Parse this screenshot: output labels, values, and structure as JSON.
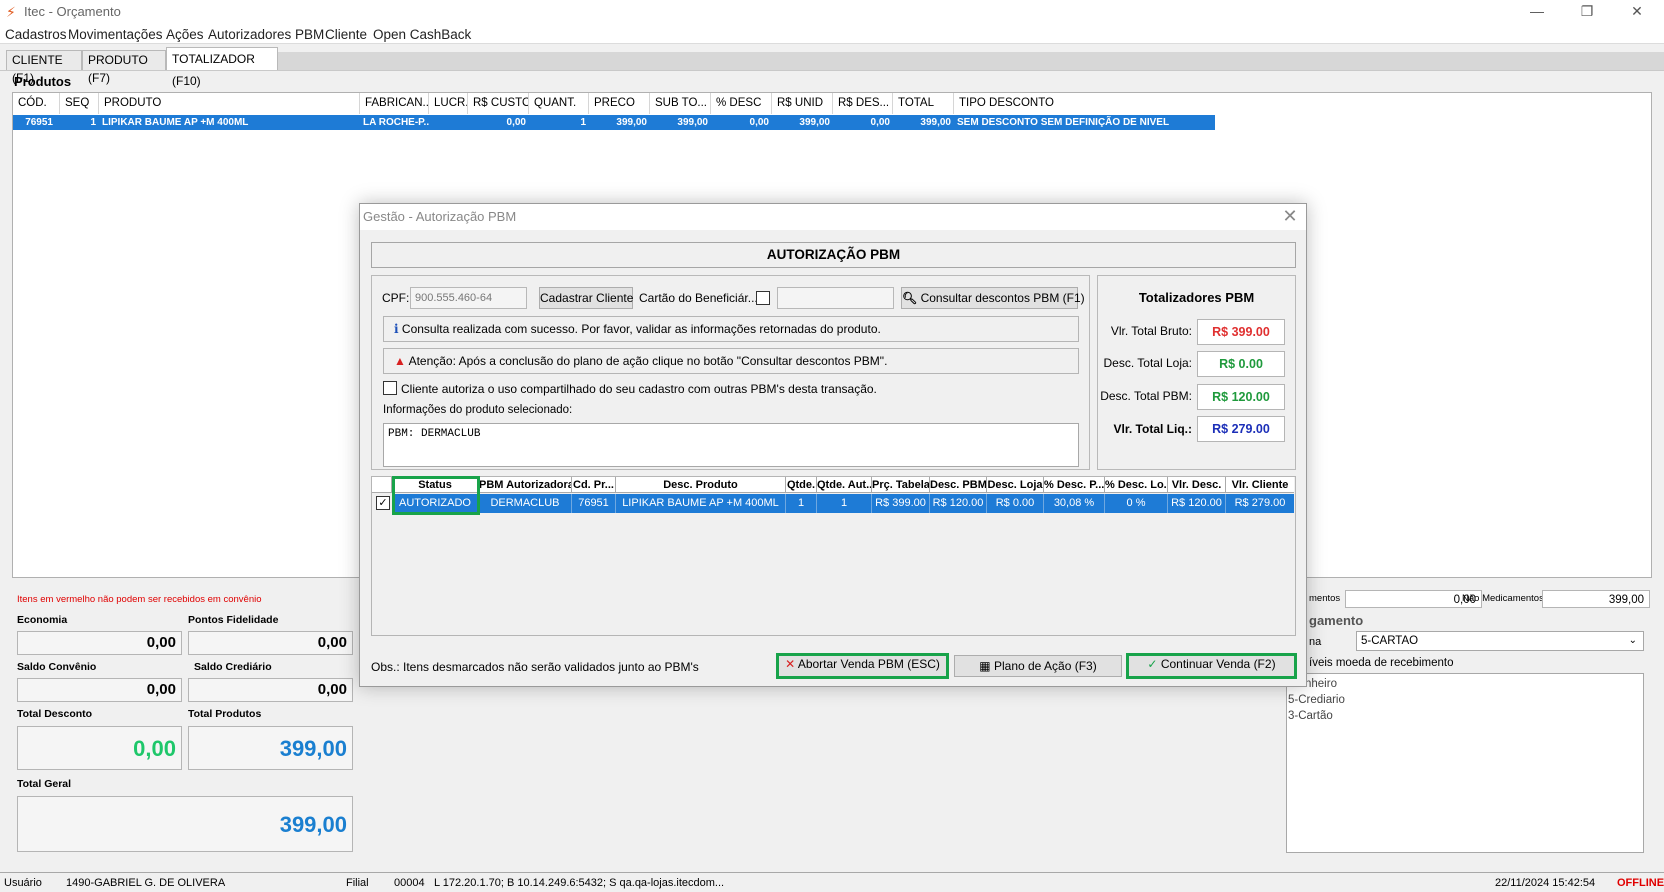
{
  "window": {
    "title": "Itec - Orçamento",
    "minimize": "—",
    "maximize": "❐",
    "close": "✕"
  },
  "menu": [
    "Cadastros",
    "Movimentações",
    "Ações",
    "Autorizadores PBM",
    "Cliente",
    "Open CashBack"
  ],
  "tabs": [
    "CLIENTE (F1)",
    "PRODUTO (F7)",
    "TOTALIZADOR (F10)"
  ],
  "products": {
    "title": "Produtos",
    "columns": [
      "CÓD.",
      "SEQ",
      "PRODUTO",
      "FABRICAN...",
      "LUCR.",
      "R$ CUSTO",
      "QUANT.",
      "PRECO",
      "SUB TO...",
      "% DESC",
      "R$ UNID",
      "R$ DES...",
      "TOTAL",
      "TIPO DESCONTO"
    ],
    "row": [
      "76951",
      "1",
      "LIPIKAR BAUME AP +M 400ML",
      "LA ROCHE-P...",
      "",
      "0,00",
      "1",
      "399,00",
      "399,00",
      "0,00",
      "399,00",
      "0,00",
      "399,00",
      "SEM DESCONTO SEM DEFINIÇÃO DE NIVEL"
    ]
  },
  "summary": {
    "red_note": "Itens em vermelho não podem ser recebidos em convênio",
    "economia_label": "Economia",
    "economia": "0,00",
    "pontos_label": "Pontos Fidelidade",
    "pontos": "0,00",
    "saldo_convenio_label": "Saldo Convênio",
    "saldo_convenio": "0,00",
    "saldo_crediario_label": "Saldo Crediário",
    "saldo_crediario": "0,00",
    "total_desconto_label": "Total Desconto",
    "total_desconto": "0,00",
    "total_produtos_label": "Total Produtos",
    "total_produtos": "399,00",
    "total_geral_label": "Total Geral",
    "total_geral": "399,00"
  },
  "right_panel": {
    "medicamentos_label": "mentos",
    "medicamentos": "0,00",
    "nao_medicamentos_label": "Não Medicamentos",
    "nao_medicamentos": "399,00",
    "orcamento_title": "gamento",
    "forma_label": "na",
    "forma_value": "5-CARTAO",
    "moedas_label": "íveis moeda de recebimento",
    "moedas": [
      "nheiro",
      "5-Crediario",
      "3-Cartão"
    ]
  },
  "status_bar": {
    "usuario_label": "Usuário",
    "usuario": "1490-GABRIEL G. DE OLIVERA",
    "filial_label": "Filial",
    "filial": "00004",
    "conn": "L 172.20.1.70; B 10.14.249.6:5432; S qa.qa-lojas.itecdom...",
    "datetime": "22/11/2024 15:42:54",
    "status": "OFFLINE"
  },
  "dialog": {
    "title": "Gestão - Autorização PBM",
    "header": "AUTORIZAÇÃO PBM",
    "cpf_label": "CPF:",
    "cpf_value": "900.555.460-64",
    "cadastrar_button": "Cadastrar Cliente",
    "cartao_label": "Cartão do Beneficiár...",
    "consultar_button": "Consultar descontos PBM (F1)",
    "info_msg": "Consulta realizada com sucesso. Por favor, validar as informações retornadas do produto.",
    "warn_msg": "Atenção: Após a conclusão do plano de ação clique no botão \"Consultar descontos PBM\".",
    "consent_label": "Cliente autoriza o uso compartilhado do seu cadastro com outras PBM's desta transação.",
    "info_label": "Informações do produto selecionado:",
    "info_text": "PBM: DERMACLUB",
    "totals": {
      "title": "Totalizadores PBM",
      "bruto_label": "Vlr. Total Bruto:",
      "bruto": "R$ 399.00",
      "loja_label": "Desc. Total Loja:",
      "loja": "R$ 0.00",
      "pbm_label": "Desc. Total PBM:",
      "pbm": "R$ 120.00",
      "liq_label": "Vlr. Total Liq.:",
      "liq": "R$ 279.00",
      "colors": {
        "bruto": "#e03030",
        "loja": "#1f9a3c",
        "pbm": "#1f9a3c",
        "liq": "#1c2fb8"
      }
    },
    "grid": {
      "columns": [
        "Status",
        "PBM Autorizadora",
        "Cd. Pr...",
        "Desc. Produto",
        "Qtde.",
        "Qtde. Aut...",
        "Prç. Tabela",
        "Desc. PBM",
        "Desc. Loja",
        "% Desc. P...",
        "% Desc. Lo...",
        "Vlr. Desc.",
        "Vlr. Cliente"
      ],
      "row": [
        "AUTORIZADO",
        "DERMACLUB",
        "76951",
        "LIPIKAR BAUME AP +M 400ML",
        "1",
        "1",
        "R$ 399.00",
        "R$ 120.00",
        "R$ 0.00",
        "30,08 %",
        "0 %",
        "R$ 120.00",
        "R$ 279.00"
      ]
    },
    "obs": "Obs.: Itens desmarcados não serão validados junto ao PBM's",
    "abortar_button": "Abortar Venda PBM (ESC)",
    "plano_button": "Plano de Ação (F3)",
    "continuar_button": "Continuar Venda (F2)"
  }
}
